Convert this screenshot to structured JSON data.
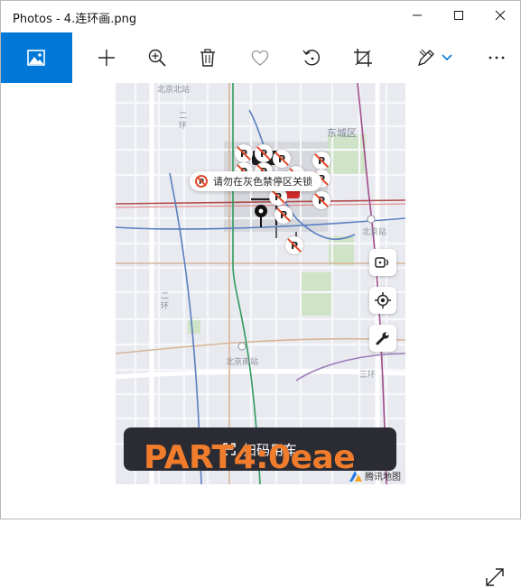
{
  "window": {
    "title": "Photos - 4.连环画.png",
    "minimize_icon": "minimize-icon",
    "maximize_icon": "maximize-icon",
    "close_icon": "close-icon"
  },
  "toolbar": {
    "icons": [
      "picture-icon",
      "add-icon",
      "zoom-in-icon",
      "delete-icon",
      "favorite-icon",
      "rotate-icon",
      "crop-icon",
      "edit-draw-icon",
      "chevron-down-icon",
      "more-icon"
    ],
    "accent": "#0078d7"
  },
  "map": {
    "labels": {
      "beijing_north": "北京北站",
      "ring2_top": "二环",
      "dongcheng": "东城区",
      "beijing_station": "北京站",
      "ring2_left": "二环",
      "beijing_south": "北京南站",
      "ring3_right": "三环"
    },
    "tooltip": "请勿在灰色禁停区关锁",
    "parking_glyph": "P",
    "scan_button": "扫码用车",
    "watermark": "PART4:0eae",
    "watermark_color": "#f07c2c",
    "provider": "腾讯地图",
    "controls": [
      "unlock-icon",
      "locate-icon",
      "wrench-icon"
    ]
  },
  "viewer": {
    "fullscreen_icon": "fullscreen-icon"
  }
}
